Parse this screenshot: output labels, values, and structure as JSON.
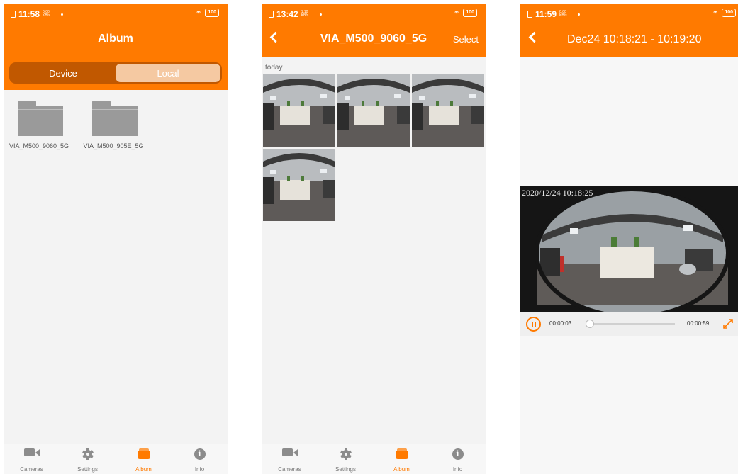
{
  "colors": {
    "accent": "#ff7a00",
    "accent_dark": "#c15800",
    "segment_light": "#f5c9a2"
  },
  "screens": [
    {
      "status": {
        "time": "11:58",
        "speed": "0.00 KB/s",
        "battery": "100"
      },
      "title": "Album",
      "segment": {
        "device_label": "Device",
        "local_label": "Local"
      },
      "folders": [
        {
          "name": "VIA_M500_9060_5G"
        },
        {
          "name": "VIA_M500_905E_5G"
        }
      ],
      "tabs": [
        {
          "label": "Cameras",
          "icon": "video-camera-icon"
        },
        {
          "label": "Settings",
          "icon": "gear-icon"
        },
        {
          "label": "Album",
          "icon": "album-icon",
          "active": true
        },
        {
          "label": "Info",
          "icon": "info-icon"
        }
      ]
    },
    {
      "status": {
        "time": "13:42",
        "speed": "1.10 KB/s",
        "battery": "100"
      },
      "title": "VIA_M500_9060_5G",
      "select_label": "Select",
      "section_label": "today",
      "thumbnail_count": 4,
      "tabs": [
        {
          "label": "Cameras",
          "icon": "video-camera-icon"
        },
        {
          "label": "Settings",
          "icon": "gear-icon"
        },
        {
          "label": "Album",
          "icon": "album-icon",
          "active": true
        },
        {
          "label": "Info",
          "icon": "info-icon"
        }
      ]
    },
    {
      "status": {
        "time": "11:59",
        "speed": "0.00 KB/s",
        "battery": "100"
      },
      "title": "Dec24 10:18:21 - 10:19:20",
      "video": {
        "timestamp": "2020/12/24 10:18:25"
      },
      "player": {
        "current_time": "00:00:03",
        "duration": "00:00:59",
        "progress_fraction": 0.05
      }
    }
  ]
}
